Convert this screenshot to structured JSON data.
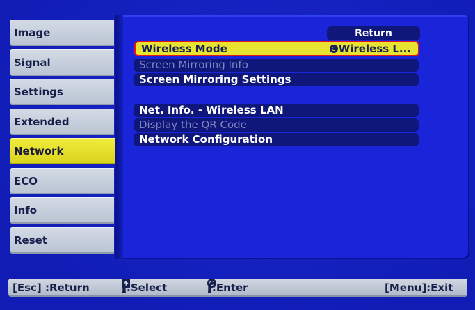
{
  "tabs": [
    {
      "label": "Image",
      "active": false
    },
    {
      "label": "Signal",
      "active": false
    },
    {
      "label": "Settings",
      "active": false
    },
    {
      "label": "Extended",
      "active": false
    },
    {
      "label": "Network",
      "active": true
    },
    {
      "label": "ECO",
      "active": false
    },
    {
      "label": "Info",
      "active": false
    },
    {
      "label": "Reset",
      "active": false
    }
  ],
  "panel": {
    "return_label": "Return",
    "items": [
      {
        "label": "Wireless Mode",
        "value": "Wireless L...",
        "value_icon": "enter-icon",
        "state": "selected"
      },
      {
        "label": "Screen Mirroring Info",
        "state": "disabled"
      },
      {
        "label": "Screen Mirroring Settings",
        "state": "enabled"
      },
      {
        "label": "Net. Info. - Wireless LAN",
        "state": "enabled"
      },
      {
        "label": "Display the QR Code",
        "state": "disabled"
      },
      {
        "label": "Network Configuration",
        "state": "enabled"
      }
    ]
  },
  "statusbar": {
    "esc_hint": "[Esc] :Return",
    "select_open": "[",
    "select_icon": "up-down-arrow-icon",
    "select_text": "]:Select",
    "enter_open": "[",
    "enter_icon": "enter-icon",
    "enter_text": "]:Enter",
    "menu_hint": "[Menu]:Exit"
  },
  "colors": {
    "background": "#1422c8",
    "highlight": "#e8e230",
    "selection_border": "#e01818",
    "tab": "#c6cedb"
  }
}
